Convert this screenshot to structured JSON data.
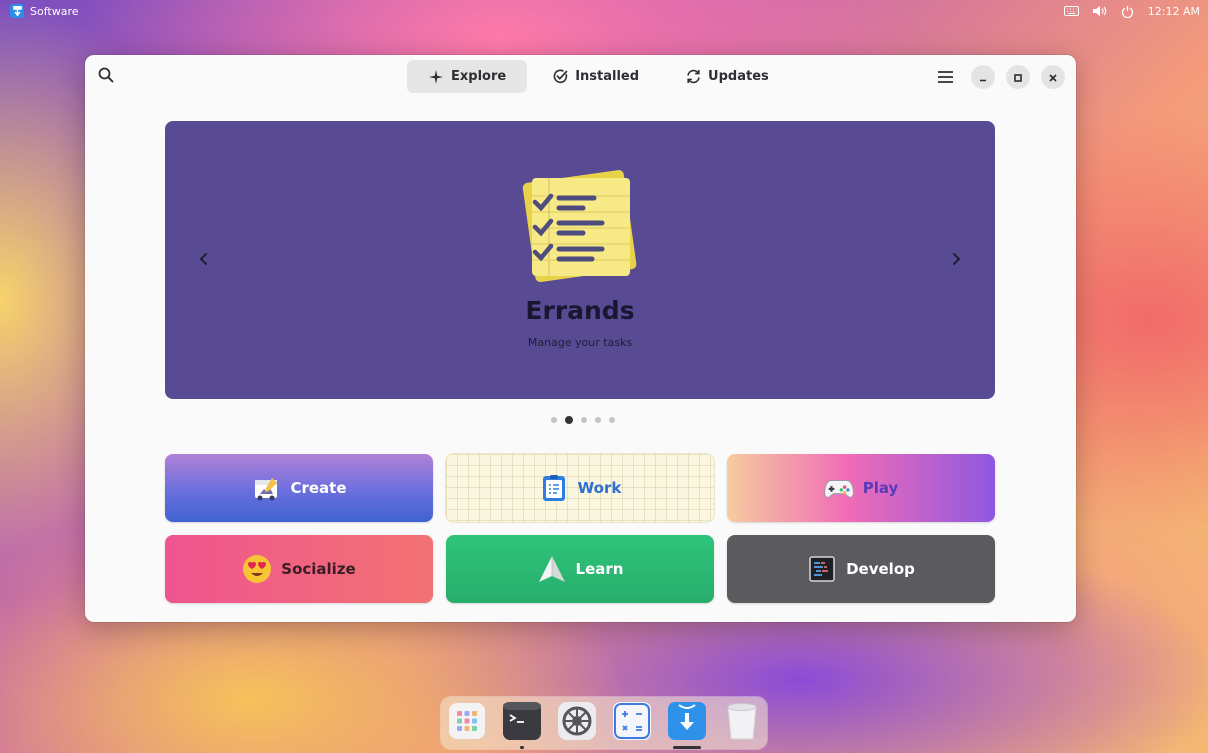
{
  "topbar": {
    "app_name": "Software",
    "clock": "12:12 AM"
  },
  "headerbar": {
    "tabs": [
      {
        "label": "Explore",
        "icon": "sparkle-icon",
        "active": true
      },
      {
        "label": "Installed",
        "icon": "check-circle-icon",
        "active": false
      },
      {
        "label": "Updates",
        "icon": "refresh-icon",
        "active": false
      }
    ]
  },
  "featured": {
    "title": "Errands",
    "subtitle": "Manage your tasks",
    "background": "#584a93",
    "pages": 5,
    "current_page": 2
  },
  "categories": [
    {
      "label": "Create",
      "icon": "create-icon"
    },
    {
      "label": "Work",
      "icon": "clipboard-icon"
    },
    {
      "label": "Play",
      "icon": "gamepad-icon"
    },
    {
      "label": "Socialize",
      "icon": "heart-eyes-emoji-icon"
    },
    {
      "label": "Learn",
      "icon": "paper-plane-icon"
    },
    {
      "label": "Develop",
      "icon": "code-editor-icon"
    }
  ],
  "dock": {
    "items": [
      {
        "name": "app-grid-icon",
        "running": false
      },
      {
        "name": "terminal-icon",
        "running": true
      },
      {
        "name": "settings-icon",
        "running": false
      },
      {
        "name": "calculator-icon",
        "running": false
      },
      {
        "name": "software-store-icon",
        "running": true,
        "focused": true
      },
      {
        "name": "trash-icon",
        "running": false
      }
    ]
  }
}
